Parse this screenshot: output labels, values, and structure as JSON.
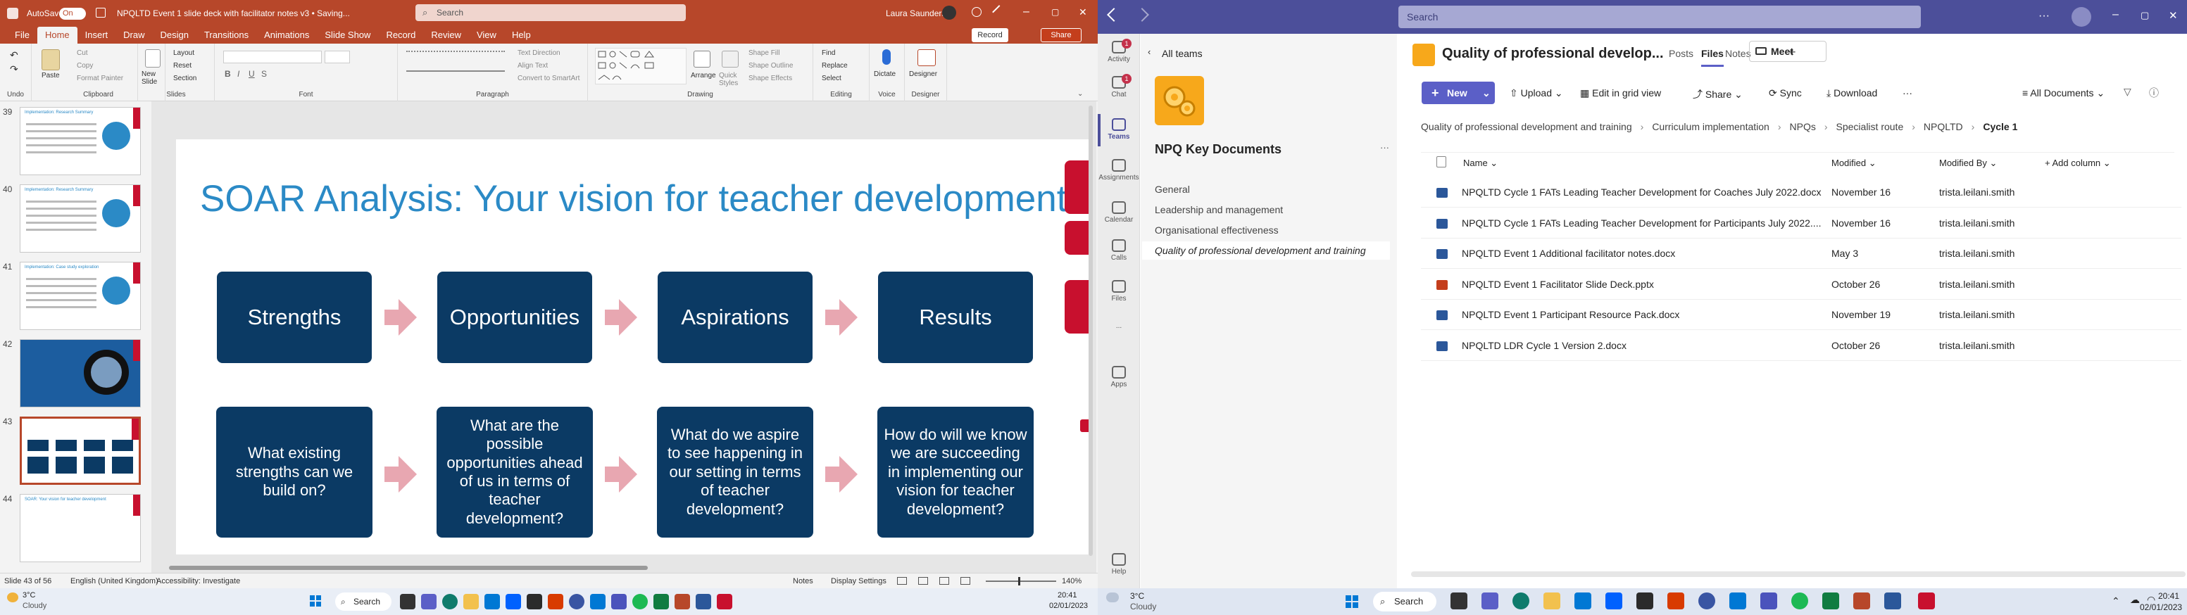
{
  "ppt": {
    "autosave_label": "AutoSave",
    "autosave_state": "On",
    "doc_title": "NPQLTD Event 1 slide deck with facilitator notes v3 • Saving...",
    "search_placeholder": "Search",
    "user_name": "Laura Saunders",
    "record_button": "Record",
    "share_button": "Share",
    "menu_tabs": [
      "File",
      "Home",
      "Insert",
      "Draw",
      "Design",
      "Transitions",
      "Animations",
      "Slide Show",
      "Record",
      "Review",
      "View",
      "Help"
    ],
    "ribbon": {
      "undo_group": "Undo",
      "clipboard": {
        "paste": "Paste",
        "cut": "Cut",
        "copy": "Copy",
        "format_painter": "Format Painter",
        "label": "Clipboard"
      },
      "slides": {
        "new_slide": "New Slide",
        "layout": "Layout",
        "reset": "Reset",
        "section": "Section",
        "label": "Slides"
      },
      "font_label": "Font",
      "paragraph": {
        "text_direction": "Text Direction",
        "align_text": "Align Text",
        "convert": "Convert to SmartArt",
        "label": "Paragraph"
      },
      "drawing": {
        "arrange": "Arrange",
        "quick_styles": "Quick Styles",
        "shape_fill": "Shape Fill",
        "shape_outline": "Shape Outline",
        "shape_effects": "Shape Effects",
        "label": "Drawing"
      },
      "editing": {
        "find": "Find",
        "replace": "Replace",
        "select": "Select",
        "label": "Editing"
      },
      "voice": {
        "dictate": "Dictate",
        "label": "Voice"
      },
      "designer": {
        "designer": "Designer",
        "label": "Designer"
      }
    },
    "thumb_numbers": [
      "39",
      "40",
      "41",
      "42",
      "43",
      "44"
    ],
    "thumb_titles": [
      "Implementation: Research Summary",
      "Implementation: Research Summary",
      "Implementation: Case study exploration",
      "",
      "",
      "SOAR: Your vision for teacher development"
    ],
    "slide": {
      "title": "SOAR Analysis: Your vision for teacher development",
      "top": [
        "Strengths",
        "Opportunities",
        "Aspirations",
        "Results"
      ],
      "bottom": [
        "What existing strengths can we build on?",
        "What are the possible opportunities ahead of us in terms of teacher development?",
        "What do we aspire to see happening in our setting in terms of teacher development?",
        "How do will we know we are succeeding in implementing our vision for teacher development?"
      ]
    },
    "status": {
      "slide_of": "Slide 43 of 56",
      "language": "English (United Kingdom)",
      "accessibility": "Accessibility: Investigate",
      "notes": "Notes",
      "display": "Display Settings",
      "zoom": "140%"
    }
  },
  "taskbar_left": {
    "weather_temp": "3°C",
    "weather_desc": "Cloudy",
    "search": "Search",
    "time": "20:41",
    "date": "02/01/2023"
  },
  "taskbar_right": {
    "weather_temp": "3°C",
    "weather_desc": "Cloudy",
    "search": "Search",
    "time": "20:41",
    "date": "02/01/2023"
  },
  "teams": {
    "search_placeholder": "Search",
    "rail": [
      {
        "label": "Activity",
        "badge": "1"
      },
      {
        "label": "Chat",
        "badge": "1"
      },
      {
        "label": "Teams",
        "badge": ""
      },
      {
        "label": "Assignments",
        "badge": ""
      },
      {
        "label": "Calendar",
        "badge": ""
      },
      {
        "label": "Calls",
        "badge": ""
      },
      {
        "label": "Files",
        "badge": ""
      },
      {
        "label": "...",
        "badge": ""
      },
      {
        "label": "Apps",
        "badge": ""
      },
      {
        "label": "Help",
        "badge": ""
      }
    ],
    "all_teams": "All teams",
    "team_name": "NPQ Key Documents",
    "channels": [
      "General",
      "Leadership and management",
      "Organisational effectiveness",
      "Quality of professional development and training"
    ],
    "channel_title": "Quality of professional develop...",
    "tabs": [
      "Posts",
      "Files",
      "Notes"
    ],
    "active_tab": "Files",
    "meet": "Meet",
    "toolbar": {
      "new": "New",
      "upload": "Upload",
      "grid": "Edit in grid view",
      "share": "Share",
      "sync": "Sync",
      "download": "Download",
      "more": "···",
      "view": "All Documents"
    },
    "breadcrumb": [
      "Quality of professional development and training",
      "Curriculum implementation",
      "NPQs",
      "Specialist route",
      "NPQLTD",
      "Cycle 1"
    ],
    "columns": {
      "name": "Name",
      "modified": "Modified",
      "modified_by": "Modified By",
      "add_column": "+ Add column"
    },
    "files": [
      {
        "name": "NPQLTD Cycle 1 FATs Leading Teacher Development for Coaches July 2022.docx",
        "modified": "November 16",
        "by": "trista.leilani.smith",
        "type": "docx"
      },
      {
        "name": "NPQLTD Cycle 1 FATs Leading Teacher Development for Participants July 2022....",
        "modified": "November 16",
        "by": "trista.leilani.smith",
        "type": "docx"
      },
      {
        "name": "NPQLTD Event 1 Additional facilitator notes.docx",
        "modified": "May 3",
        "by": "trista.leilani.smith",
        "type": "docx"
      },
      {
        "name": "NPQLTD Event 1 Facilitator Slide Deck.pptx",
        "modified": "October 26",
        "by": "trista.leilani.smith",
        "type": "pptx"
      },
      {
        "name": "NPQLTD Event 1 Participant Resource Pack.docx",
        "modified": "November 19",
        "by": "trista.leilani.smith",
        "type": "docx"
      },
      {
        "name": "NPQLTD LDR Cycle 1 Version 2.docx",
        "modified": "October 26",
        "by": "trista.leilani.smith",
        "type": "docx"
      }
    ]
  },
  "colors": {
    "ppt_accent": "#b7472a",
    "teams_purple": "#4c4f9a",
    "slide_box": "#0b3a64",
    "slide_title": "#2b8ac6",
    "arrow": "#e8a7b1",
    "docx": "#2b579a",
    "pptx": "#c43e1c"
  }
}
